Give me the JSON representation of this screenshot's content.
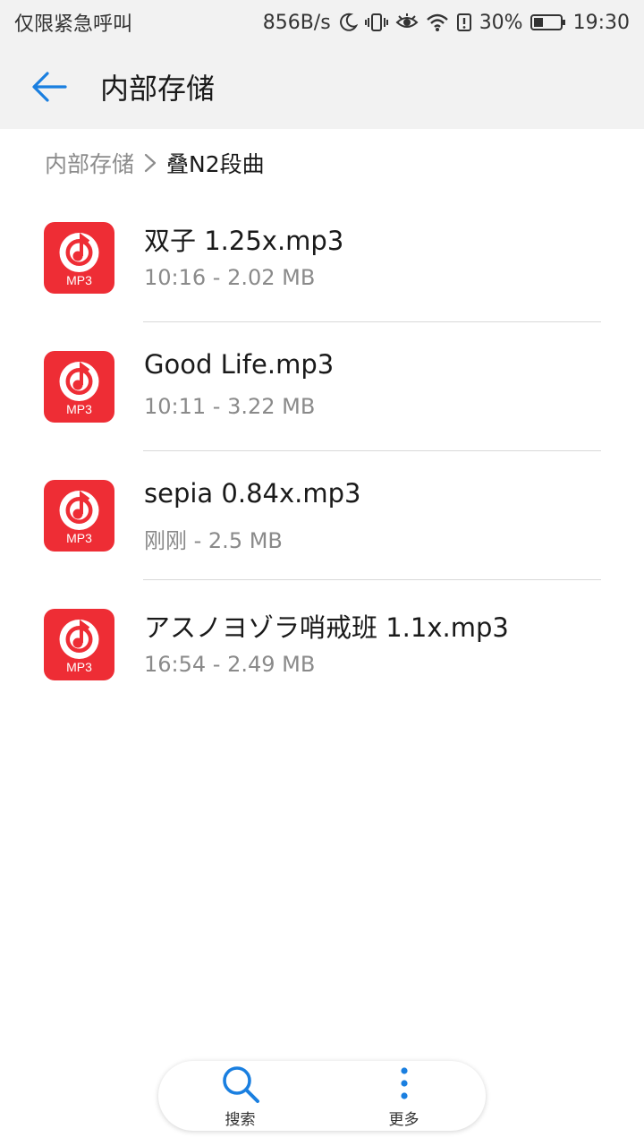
{
  "status_bar": {
    "left_text": "仅限紧急呼叫",
    "speed": "856B/s",
    "battery": "30%",
    "time": "19:30",
    "icons": [
      "moon-icon",
      "vibrate-icon",
      "eye-icon",
      "wifi-icon",
      "alert-icon",
      "battery-icon"
    ]
  },
  "header": {
    "title": "内部存储",
    "back_icon": "arrow-left-icon"
  },
  "breadcrumb": {
    "root": "内部存储",
    "current": "叠N2段曲"
  },
  "files": [
    {
      "name": "双子 1.25x.mp3",
      "meta": "10:16 - 2.02 MB",
      "icon_label": "MP3"
    },
    {
      "name": "Good Life.mp3",
      "meta": "10:11 - 3.22 MB",
      "icon_label": "MP3"
    },
    {
      "name": "sepia 0.84x.mp3",
      "meta": "刚刚 - 2.5 MB",
      "icon_label": "MP3"
    },
    {
      "name": "アスノヨゾラ哨戒班 1.1x.mp3",
      "meta": "16:54 - 2.49 MB",
      "icon_label": "MP3"
    }
  ],
  "bottom_bar": {
    "search_label": "搜索",
    "more_label": "更多"
  },
  "colors": {
    "accent": "#1a7fe0",
    "mp3_icon": "#ee2d35",
    "header_bg": "#f2f2f2"
  }
}
